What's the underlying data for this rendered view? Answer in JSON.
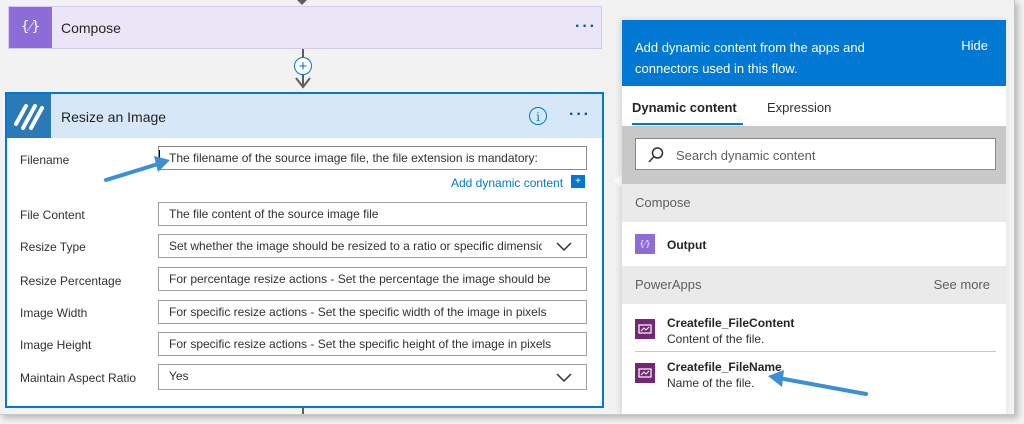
{
  "compose": {
    "title": "Compose",
    "more": "···"
  },
  "insert_step": "+",
  "resize": {
    "title": "Resize an Image",
    "info": "i",
    "more": "···",
    "fields": [
      {
        "label": "Filename",
        "value": "The filename of the source image file, the file extension is mandatory:"
      },
      {
        "label": "File Content",
        "value": "The file content of the source image file"
      },
      {
        "label": "Resize Type",
        "value": "Set whether the image should be resized to a ratio or specific dimension"
      },
      {
        "label": "Resize Percentage",
        "value": "For percentage resize actions - Set the percentage the image should be"
      },
      {
        "label": "Image Width",
        "value": "For specific resize actions - Set the specific width of the image in pixels"
      },
      {
        "label": "Image Height",
        "value": "For specific resize actions - Set the specific height of the image in pixels"
      },
      {
        "label": "Maintain Aspect Ratio",
        "value": "Yes"
      }
    ],
    "add_dynamic": "Add dynamic content",
    "add_dynamic_icon": "+"
  },
  "panel": {
    "header_text": "Add dynamic content from the apps and connectors used in this flow.",
    "hide": "Hide",
    "tabs": [
      "Dynamic content",
      "Expression"
    ],
    "search_placeholder": "Search dynamic content",
    "sections": [
      {
        "title": "Compose",
        "items": [
          {
            "title": "Output"
          }
        ]
      },
      {
        "title": "PowerApps",
        "see_more": "See more",
        "items": [
          {
            "title": "Createfile_FileContent",
            "desc": "Content of the file."
          },
          {
            "title": "Createfile_FileName",
            "desc": "Name of the file."
          }
        ]
      }
    ]
  },
  "colors": {
    "accent": "#0078d4",
    "compose_purple": "#8c6cd9",
    "powerapps_purple": "#742774",
    "callout_arrow": "#3b8fd6"
  }
}
